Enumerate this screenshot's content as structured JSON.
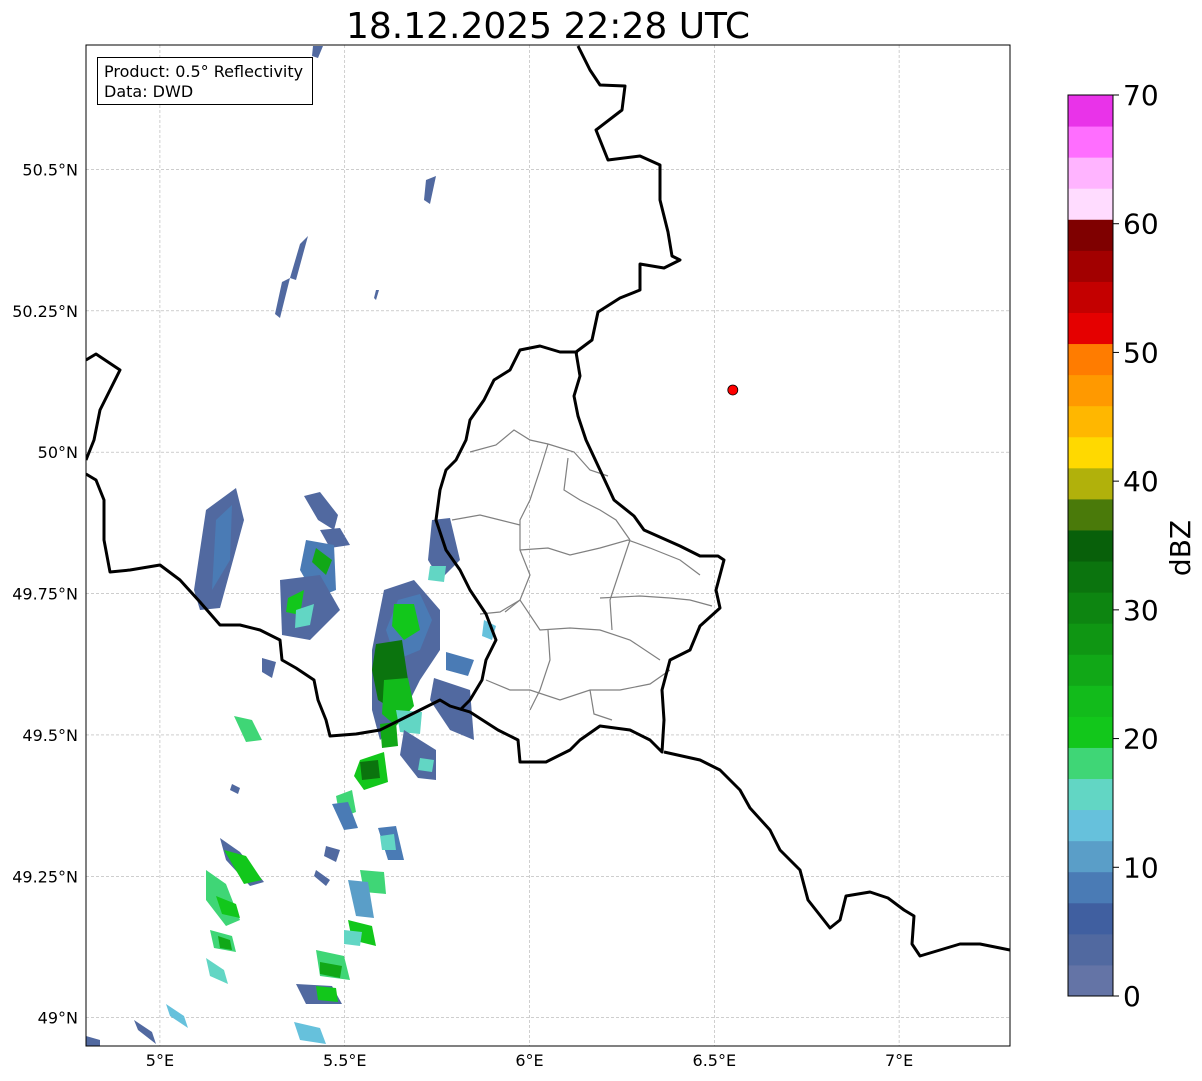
{
  "title": "18.12.2025 22:28 UTC",
  "info_box": {
    "product": "Product: 0.5° Reflectivity",
    "data": "Data: DWD"
  },
  "map": {
    "lon_range": [
      4.8,
      7.3
    ],
    "lat_range": [
      48.95,
      50.72
    ],
    "lon_ticks": [
      {
        "value": 5.0,
        "label": "5°E"
      },
      {
        "value": 5.5,
        "label": "5.5°E"
      },
      {
        "value": 6.0,
        "label": "6°E"
      },
      {
        "value": 6.5,
        "label": "6.5°E"
      },
      {
        "value": 7.0,
        "label": "7°E"
      }
    ],
    "lat_ticks": [
      {
        "value": 50.5,
        "label": "50.5°N"
      },
      {
        "value": 50.25,
        "label": "50.25°N"
      },
      {
        "value": 50.0,
        "label": "50°N"
      },
      {
        "value": 49.75,
        "label": "49.75°N"
      },
      {
        "value": 49.5,
        "label": "49.5°N"
      },
      {
        "value": 49.25,
        "label": "49.25°N"
      },
      {
        "value": 49.0,
        "label": "49°N"
      }
    ],
    "radar_site": {
      "lon": 6.55,
      "lat": 50.11,
      "color": "#ff0000"
    },
    "gridlines": true
  },
  "colorbar": {
    "label": "dBZ",
    "min": 0,
    "max": 70,
    "tick_labels": [
      {
        "value": 0,
        "label": "0"
      },
      {
        "value": 10,
        "label": "10"
      },
      {
        "value": 20,
        "label": "20"
      },
      {
        "value": 30,
        "label": "30"
      },
      {
        "value": 40,
        "label": "40"
      },
      {
        "value": 50,
        "label": "50"
      },
      {
        "value": 60,
        "label": "60"
      },
      {
        "value": 70,
        "label": "70"
      }
    ],
    "colors": [
      "#6474a6",
      "#5169a0",
      "#405fa0",
      "#4a7bb5",
      "#5a9ec8",
      "#66c1dc",
      "#62d6c4",
      "#3fd676",
      "#12c71b",
      "#12bb1b",
      "#11a817",
      "#0f9613",
      "#0d8511",
      "#0b740e",
      "#08600a",
      "#4a7a0a",
      "#b1b10b",
      "#ffd900",
      "#ffb700",
      "#ff9900",
      "#ff7c00",
      "#e50000",
      "#c40000",
      "#a20000",
      "#7f0000",
      "#ffdcff",
      "#ffb4ff",
      "#ff6eff",
      "#e933e9"
    ]
  }
}
